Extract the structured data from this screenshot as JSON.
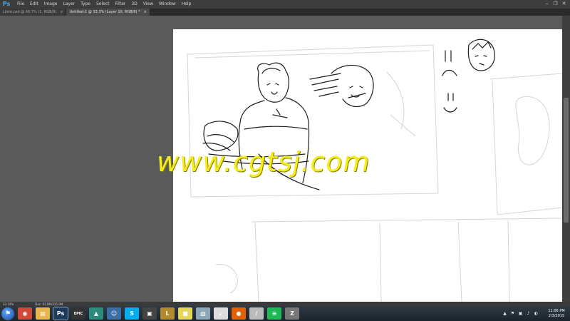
{
  "app": {
    "logo_text": "Ps",
    "accent": "#4ea6e6"
  },
  "menu": [
    "File",
    "Edit",
    "Image",
    "Layer",
    "Type",
    "Select",
    "Filter",
    "3D",
    "View",
    "Window",
    "Help"
  ],
  "window_controls": {
    "minimize": "‒",
    "restore": "❐",
    "close": "✕"
  },
  "tabs": [
    {
      "label": "Linke.psd @ 66.7% (1, RGB/8)",
      "close": "×",
      "active": false
    },
    {
      "label": "Untitled-1 @ 33.3% (Layer 10, RGB/8) *",
      "close": "×",
      "active": true
    }
  ],
  "status": {
    "zoom": "33.33%",
    "doc": "Doc: 61.8M/315.9M"
  },
  "watermark": "www.cgtsj.com",
  "taskbar": {
    "apps": [
      {
        "name": "chrome-icon",
        "glyph": "◉",
        "color": "#d14836",
        "active": false
      },
      {
        "name": "folder-icon",
        "glyph": "▤",
        "color": "#e8b64a",
        "active": false
      },
      {
        "name": "photoshop-icon",
        "glyph": "Ps",
        "color": "#1b3a5c",
        "active": true
      },
      {
        "name": "epic-launcher-icon",
        "glyph": "EPIC",
        "color": "#333333",
        "active": false
      },
      {
        "name": "app-triangle-icon",
        "glyph": "▲",
        "color": "#2a8c7a",
        "active": false
      },
      {
        "name": "app-person-icon",
        "glyph": "☺",
        "color": "#3a6ea5",
        "active": false
      },
      {
        "name": "skype-icon",
        "glyph": "S",
        "color": "#00aff0",
        "active": false
      },
      {
        "name": "app-box-icon",
        "glyph": "▣",
        "color": "#444444",
        "active": false
      },
      {
        "name": "league-icon",
        "glyph": "L",
        "color": "#b38b2d",
        "active": false
      },
      {
        "name": "notes-icon",
        "glyph": "■",
        "color": "#e6d65a",
        "active": false
      },
      {
        "name": "app-slate-icon",
        "glyph": "▧",
        "color": "#8aa8b8",
        "active": false
      },
      {
        "name": "rocket-icon",
        "glyph": "➹",
        "color": "#dddddd",
        "active": false
      },
      {
        "name": "firefox-icon",
        "glyph": "●",
        "color": "#e66000",
        "active": false
      },
      {
        "name": "pen-icon",
        "glyph": "/",
        "color": "#bbbbbb",
        "active": false
      },
      {
        "name": "spotify-icon",
        "glyph": "≡",
        "color": "#1db954",
        "active": false
      },
      {
        "name": "zbrush-icon",
        "glyph": "Z",
        "color": "#777777",
        "active": false
      }
    ],
    "tray": [
      "▲",
      "⚑",
      "▣",
      "♪",
      "◐"
    ],
    "time": "11:06 PM",
    "date": "2/3/2015"
  }
}
